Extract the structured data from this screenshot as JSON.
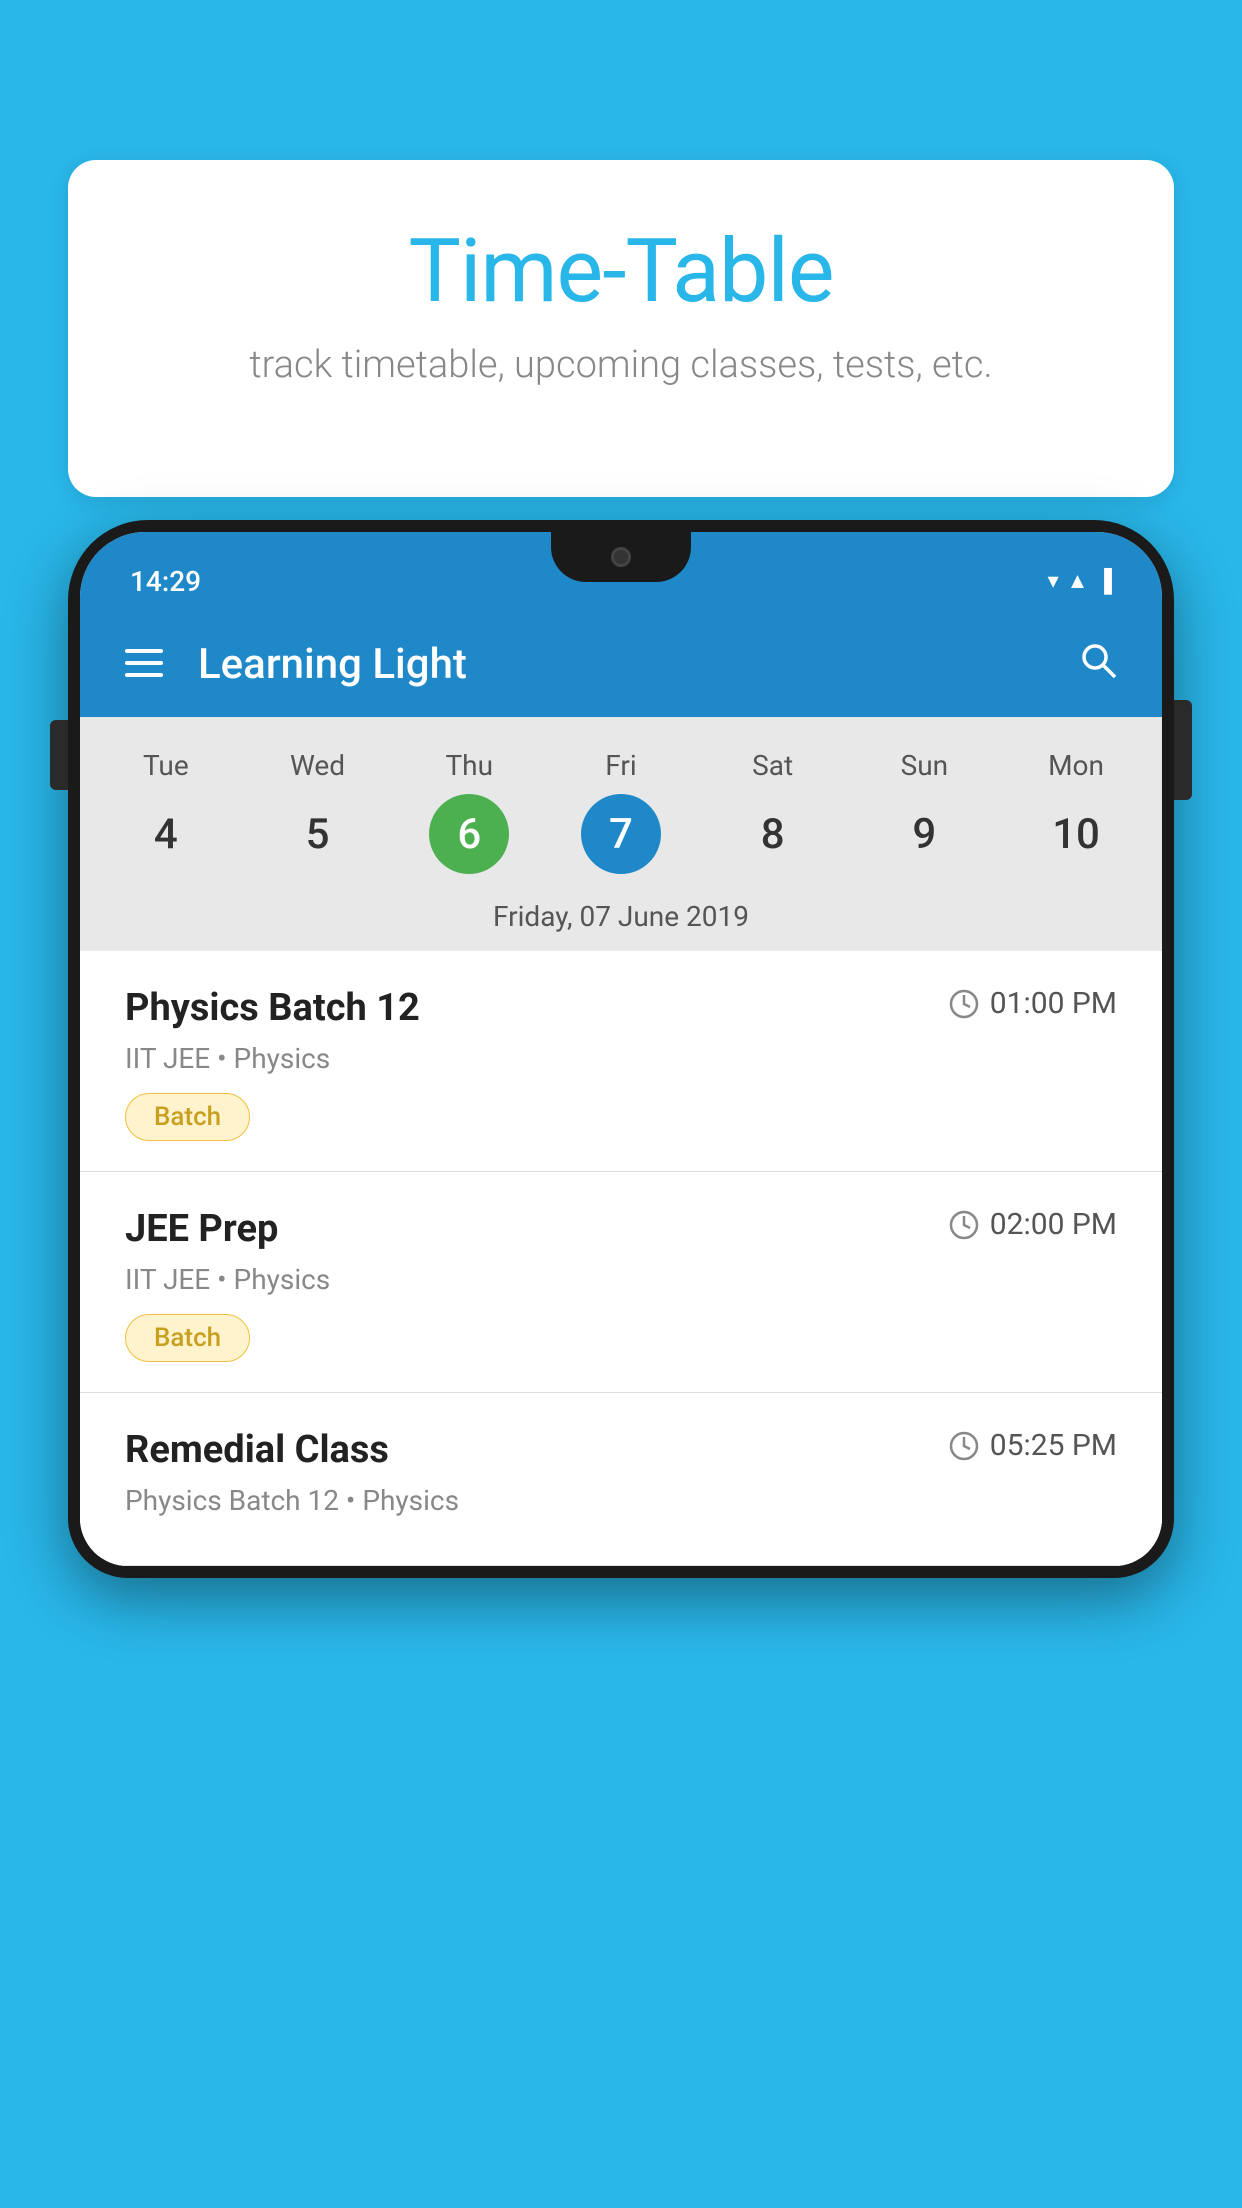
{
  "background_color": "#29b6e8",
  "bubble": {
    "title": "Time-Table",
    "subtitle": "track timetable, upcoming classes, tests, etc."
  },
  "phone": {
    "status_bar": {
      "time": "14:29"
    },
    "header": {
      "title": "Learning Light"
    },
    "calendar": {
      "days": [
        {
          "name": "Tue",
          "number": "4",
          "state": "normal"
        },
        {
          "name": "Wed",
          "number": "5",
          "state": "normal"
        },
        {
          "name": "Thu",
          "number": "6",
          "state": "today"
        },
        {
          "name": "Fri",
          "number": "7",
          "state": "selected"
        },
        {
          "name": "Sat",
          "number": "8",
          "state": "normal"
        },
        {
          "name": "Sun",
          "number": "9",
          "state": "normal"
        },
        {
          "name": "Mon",
          "number": "10",
          "state": "normal"
        }
      ],
      "selected_date_label": "Friday, 07 June 2019"
    },
    "schedule": [
      {
        "title": "Physics Batch 12",
        "time": "01:00 PM",
        "subtitle": "IIT JEE • Physics",
        "badge": "Batch"
      },
      {
        "title": "JEE Prep",
        "time": "02:00 PM",
        "subtitle": "IIT JEE • Physics",
        "badge": "Batch"
      },
      {
        "title": "Remedial Class",
        "time": "05:25 PM",
        "subtitle": "Physics Batch 12 • Physics",
        "badge": null
      }
    ]
  }
}
